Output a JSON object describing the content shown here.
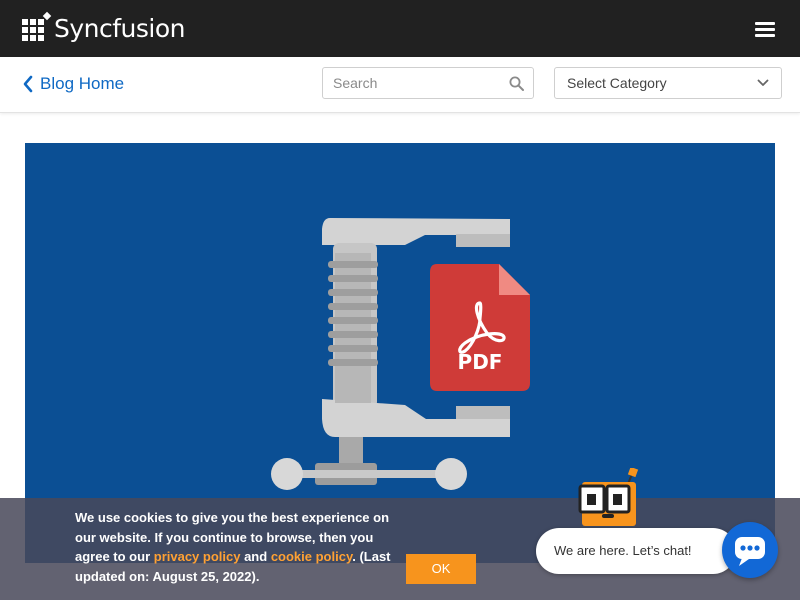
{
  "header": {
    "brand": "Syncfusion",
    "logo_icon": "syncfusion-grid-logo",
    "menu_icon": "hamburger-menu-icon"
  },
  "subnav": {
    "back_label": "Blog Home",
    "search_placeholder": "Search",
    "category_selected": "Select Category"
  },
  "hero": {
    "badge_text": "PDF",
    "background_color": "#0b4f94",
    "pdf_color": "#cf3b38"
  },
  "cookie": {
    "text_before": "We use cookies to give you the best experience on our website. If you continue to browse, then you agree to our ",
    "privacy_link": "privacy policy",
    "text_and": " and ",
    "cookie_link": "cookie policy",
    "text_after": ". (Last updated on: August 25, 2022).",
    "ok_label": "OK"
  },
  "chat": {
    "message": "We are here. Let’s chat!",
    "button_icon": "chat-icon"
  }
}
